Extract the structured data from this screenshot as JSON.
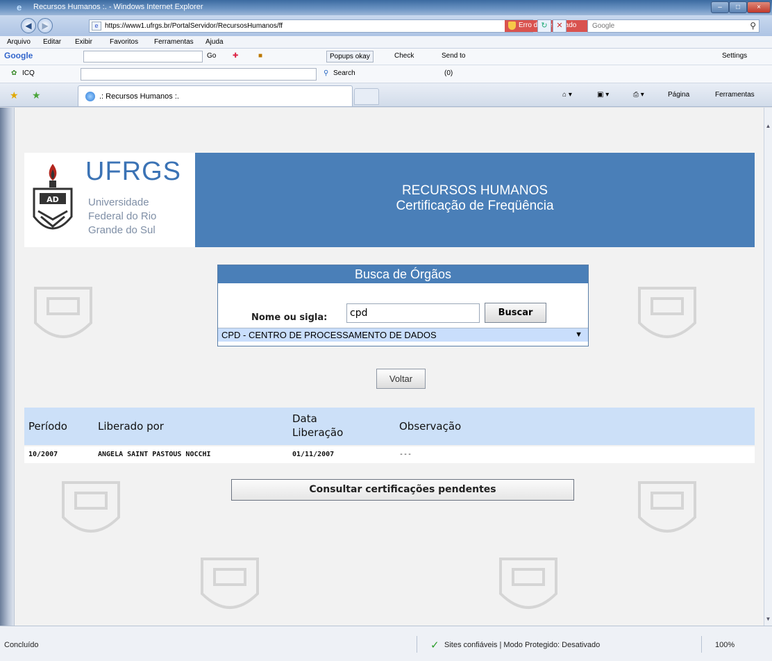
{
  "window": {
    "title": "Recursos Humanos :. - Windows Internet Explorer",
    "min_glyph": "–",
    "max_glyph": "□",
    "close_glyph": "×"
  },
  "address_bar": {
    "url": "https://www1.ufrgs.br/PortalServidor/RecursosHumanos/ff",
    "cert_error": "Erro do Certificado",
    "search_placeholder": "Google",
    "search_icon": "search-icon"
  },
  "menu": {
    "items": [
      "Arquivo",
      "Editar",
      "Exibir",
      "Favoritos",
      "Ferramentas",
      "Ajuda"
    ]
  },
  "google_toolbar": {
    "logo": "Google",
    "go": "Go",
    "popups": "Popups okay",
    "check": "Check",
    "send_to": "Send to",
    "settings": "Settings"
  },
  "icq_toolbar": {
    "logo": "ICQ",
    "search": "Search",
    "mail_count": "(0)"
  },
  "tabs": {
    "active_title": ".: Recursos Humanos :.",
    "pagina": "Página",
    "ferramentas": "Ferramentas"
  },
  "page": {
    "logo_title": "UFRGS",
    "logo_sub": [
      "Universidade",
      "Federal do Rio",
      "Grande do Sul"
    ],
    "banner_line1": "RECURSOS HUMANOS",
    "banner_line2": "Certificação de Freqüência",
    "busca": {
      "header": "Busca de Órgãos",
      "label": "Nome ou sigla:",
      "input_value": "cpd",
      "button": "Buscar",
      "selected_option": "CPD - CENTRO DE PROCESSAMENTO DE DADOS"
    },
    "voltar": "Voltar",
    "table": {
      "headers": [
        "Período",
        "Liberado por",
        "Data Liberação",
        "Observação"
      ],
      "rows": [
        [
          "10/2007",
          "ANGELA SAINT PASTOUS NOCCHI",
          "01/11/2007",
          "---"
        ]
      ]
    },
    "consultar": "Consultar certificações pendentes"
  },
  "status": {
    "left": "Concluído",
    "zone": "Sites confiáveis | Modo Protegido: Desativado",
    "zoom": "100%"
  },
  "colors": {
    "banner": "#4a7fb8",
    "table_header": "#cce0f8",
    "select_highlight": "#c9defc",
    "logo_blue": "#3b73b5"
  }
}
